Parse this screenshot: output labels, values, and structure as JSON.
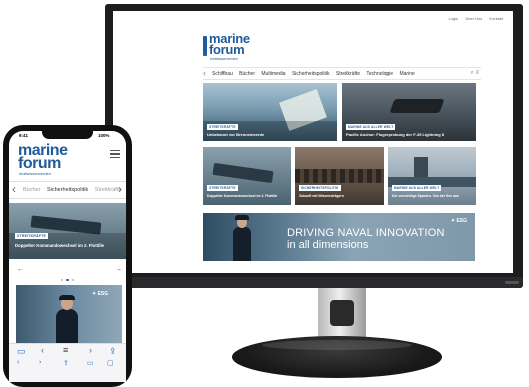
{
  "desktop": {
    "top_links": [
      "Login",
      "Über Uns",
      "Kontakt"
    ],
    "logo": {
      "line1": "marine",
      "line2": "forum",
      "tagline": "#mitwisserwerden"
    },
    "nav": {
      "items": [
        "Schiffbau",
        "Bücher",
        "Multimedia",
        "Sicherheitspolitik",
        "Streitkräfte",
        "Technologie",
        "Marine"
      ],
      "search_icon": "search-icon",
      "menu_icon": "menu-icon"
    },
    "cards": [
      {
        "badge": "Streitkräfte",
        "title": "Unbekannt vor Brennemeerde"
      },
      {
        "badge": "Marine aus aller Welt",
        "title": "Pacific Anchor: Flugerprobung der F-35 Lightning II"
      },
      {
        "badge": "Streitkräfte",
        "title": "Doppelter Kommandowechsel im 2. Flottille"
      },
      {
        "badge": "Sicherheitspolitik",
        "title": "Zukunft mit Wissensträgern"
      },
      {
        "badge": "Marine aus aller Welt",
        "title": "Der vorsichtige Spanien. Von der See aus"
      }
    ],
    "ad": {
      "line1": "DRIVING NAVAL INNOVATION",
      "line2": "in all dimensions",
      "brand": "ESG"
    }
  },
  "phone": {
    "status": {
      "time": "9:41",
      "battery": "100%"
    },
    "logo": {
      "line1": "marine",
      "line2": "forum",
      "tagline": "#mitwisserwerden"
    },
    "nav": {
      "items": [
        "Bücher",
        "Sicherheitspolitik",
        "Streitkräfte"
      ]
    },
    "feature": {
      "badge": "Streitkräfte",
      "title": "Doppelter Kommandowechsel im 2. Flottille"
    },
    "carousel": {
      "prev": "←",
      "next": "→"
    },
    "ad": {
      "brand": "ESG"
    },
    "toolbar": {
      "back": "‹",
      "forward": "›",
      "share": "⇪",
      "bookmarks": "▭",
      "tabs": "▢"
    }
  }
}
